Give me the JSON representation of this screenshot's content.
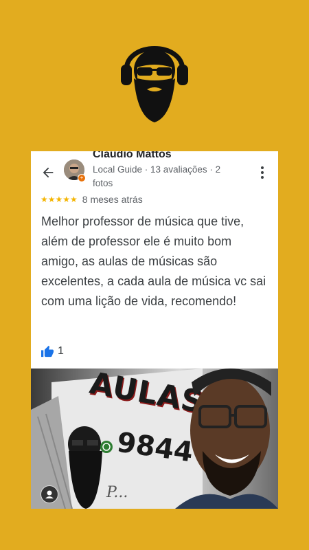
{
  "review": {
    "author_name": "Claudio Mattos",
    "author_meta": "Local Guide · 13 avaliações · 2 fotos",
    "stars": "★★★★★",
    "rating": 5,
    "time_ago": "8 meses atrás",
    "text": "Melhor professor de música que tive, além de professor ele é muito bom amigo, as aulas de músicas são excelentes, a cada aula de música vc sai com uma lição de vida, recomendo!",
    "likes": "1"
  },
  "photo": {
    "sign_text": "AULAS",
    "sign_number": "9844",
    "sign_script": "P..."
  },
  "colors": {
    "background": "#E2AC1F",
    "star": "#F4B400",
    "like": "#1A73E8",
    "badge": "#E8710A"
  }
}
